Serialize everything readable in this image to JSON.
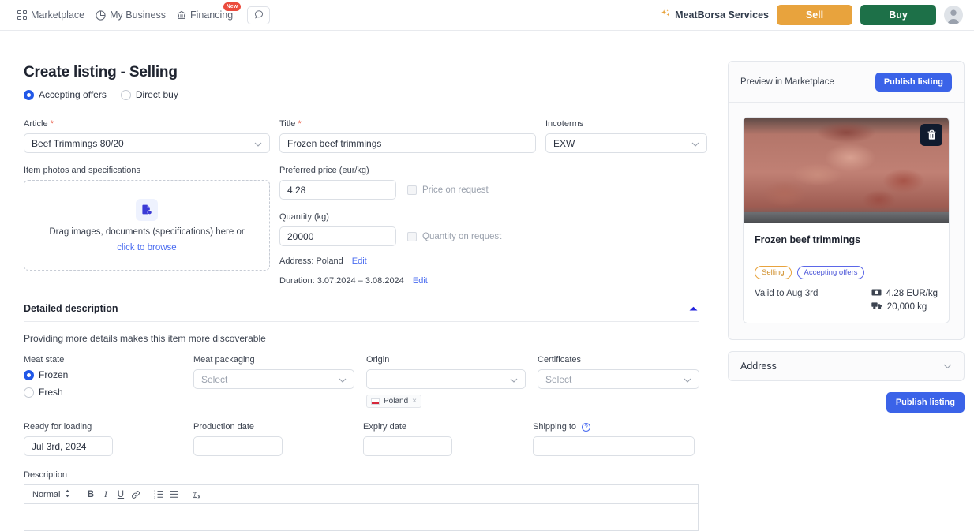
{
  "nav": {
    "items": [
      {
        "label": "Marketplace",
        "icon": "grid-icon"
      },
      {
        "label": "My Business",
        "icon": "pie-chart-icon"
      },
      {
        "label": "Financing",
        "icon": "bank-icon",
        "badge": "New"
      }
    ],
    "chat_icon": "chat-bubble-icon",
    "services_label": "MeatBorsa Services",
    "sell_label": "Sell",
    "buy_label": "Buy",
    "colors": {
      "sell": "#e8a33d",
      "buy": "#1d7048",
      "badge": "#eb4b3d",
      "primary": "#3b63e8"
    }
  },
  "form": {
    "title": "Create listing - Selling",
    "listing_type": {
      "options": [
        "Accepting offers",
        "Direct buy"
      ],
      "selected": "Accepting offers"
    },
    "article": {
      "label": "Article",
      "required": "*",
      "value": "Beef Trimmings 80/20"
    },
    "title_field": {
      "label": "Title",
      "required": "*",
      "value": "Frozen beef trimmings"
    },
    "incoterms": {
      "label": "Incoterms",
      "value": "EXW"
    },
    "photos": {
      "label": "Item photos and specifications",
      "drag_text": "Drag images, documents (specifications) here or",
      "browse_text": "click to browse",
      "icon": "document-upload-icon"
    },
    "price": {
      "label": "Preferred price (eur/kg)",
      "value": "4.28",
      "on_request_label": "Price on request",
      "on_request_checked": false
    },
    "quantity": {
      "label": "Quantity (kg)",
      "value": "20000",
      "on_request_label": "Quantity on request",
      "on_request_checked": false
    },
    "address_line": {
      "text": "Address: Poland",
      "edit": "Edit"
    },
    "duration_line": {
      "text": "Duration: 3.07.2024 – 3.08.2024",
      "edit": "Edit"
    }
  },
  "details": {
    "section_title": "Detailed description",
    "subtitle": "Providing more details makes this item more discoverable",
    "collapse_icon": "chevron-up-icon",
    "meat_state": {
      "label": "Meat state",
      "options": [
        "Frozen",
        "Fresh"
      ],
      "selected": "Frozen"
    },
    "meat_packaging": {
      "label": "Meat packaging",
      "placeholder": "Select",
      "value": ""
    },
    "origin": {
      "label": "Origin",
      "placeholder": "",
      "value": "",
      "chips": [
        {
          "label": "Poland",
          "flag": "flag-poland"
        }
      ]
    },
    "certificates": {
      "label": "Certificates",
      "placeholder": "Select",
      "value": ""
    },
    "ready_for_loading": {
      "label": "Ready for loading",
      "value": "Jul 3rd, 2024"
    },
    "production_date": {
      "label": "Production date",
      "value": ""
    },
    "expiry_date": {
      "label": "Expiry date",
      "value": ""
    },
    "shipping_to": {
      "label": "Shipping to",
      "value": "",
      "help_icon": "help-circle-icon"
    },
    "description": {
      "label": "Description",
      "toolbar": {
        "style": "Normal",
        "buttons": [
          {
            "name": "bold",
            "glyph": "B"
          },
          {
            "name": "italic",
            "glyph": "I"
          },
          {
            "name": "underline",
            "glyph": "U"
          },
          {
            "name": "link",
            "glyph": "🔗"
          },
          {
            "name": "ordered-list",
            "glyph": "1."
          },
          {
            "name": "bullet-list",
            "glyph": "≡"
          },
          {
            "name": "clear-format",
            "glyph": "Tx"
          }
        ]
      },
      "value": ""
    }
  },
  "preview": {
    "header_label": "Preview in Marketplace",
    "publish_label": "Publish listing",
    "delete_icon": "trash-icon",
    "card": {
      "title": "Frozen beef trimmings",
      "tags": [
        {
          "label": "Selling",
          "color": "#d08f2c"
        },
        {
          "label": "Accepting offers",
          "color": "#4a55d8"
        }
      ],
      "valid_to": "Valid to Aug 3rd",
      "price": "4.28 EUR/kg",
      "price_icon": "banknote-icon",
      "quantity": "20,000 kg",
      "quantity_icon": "truck-icon"
    },
    "address_section": {
      "label": "Address",
      "chevron": "chevron-down-icon"
    },
    "publish_bottom_label": "Publish listing"
  }
}
